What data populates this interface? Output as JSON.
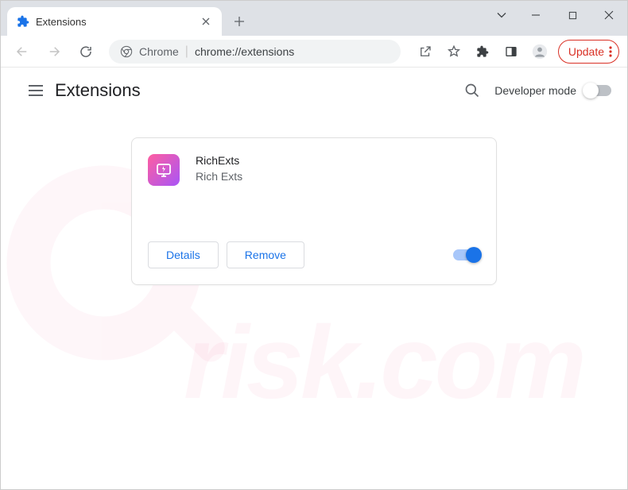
{
  "window": {
    "tab_title": "Extensions"
  },
  "toolbar": {
    "chrome_label": "Chrome",
    "url": "chrome://extensions",
    "update_label": "Update"
  },
  "header": {
    "title": "Extensions",
    "dev_mode_label": "Developer mode"
  },
  "extension": {
    "name": "RichExts",
    "description": "Rich Exts",
    "details_label": "Details",
    "remove_label": "Remove"
  }
}
